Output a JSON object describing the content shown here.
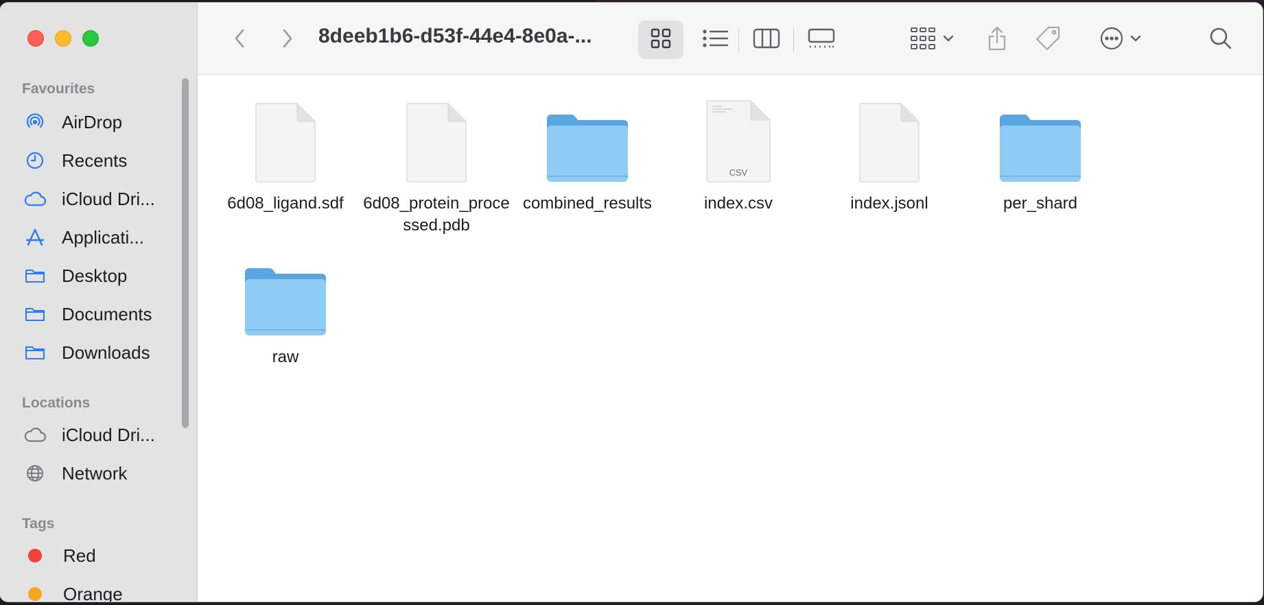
{
  "window": {
    "title": "8deeb1b6-d53f-44e4-8e0a-..."
  },
  "sidebar": {
    "favourites_title": "Favourites",
    "favourites": [
      {
        "label": "AirDrop",
        "icon": "airdrop-icon"
      },
      {
        "label": "Recents",
        "icon": "clock-icon"
      },
      {
        "label": "iCloud Dri...",
        "icon": "cloud-icon"
      },
      {
        "label": "Applicati...",
        "icon": "applications-icon"
      },
      {
        "label": "Desktop",
        "icon": "folder-icon"
      },
      {
        "label": "Documents",
        "icon": "folder-icon"
      },
      {
        "label": "Downloads",
        "icon": "folder-icon"
      }
    ],
    "locations_title": "Locations",
    "locations": [
      {
        "label": "iCloud Dri...",
        "icon": "cloud-icon"
      },
      {
        "label": "Network",
        "icon": "globe-icon"
      }
    ],
    "tags_title": "Tags",
    "tags": [
      {
        "label": "Red",
        "color": "#f0423a"
      },
      {
        "label": "Orange",
        "color": "#f5a623"
      }
    ]
  },
  "files": [
    {
      "name": "6d08_ligand.sdf",
      "kind": "document"
    },
    {
      "name": "6d08_protein_processed.pdb",
      "kind": "document"
    },
    {
      "name": "combined_results",
      "kind": "folder"
    },
    {
      "name": "index.csv",
      "kind": "csv",
      "badge": "CSV"
    },
    {
      "name": "index.jsonl",
      "kind": "document"
    },
    {
      "name": "per_shard",
      "kind": "folder"
    },
    {
      "name": "raw",
      "kind": "folder"
    }
  ],
  "colors": {
    "accent": "#2a7cf6",
    "folder_front": "#8ecbf5",
    "folder_back": "#5aa6e2"
  }
}
